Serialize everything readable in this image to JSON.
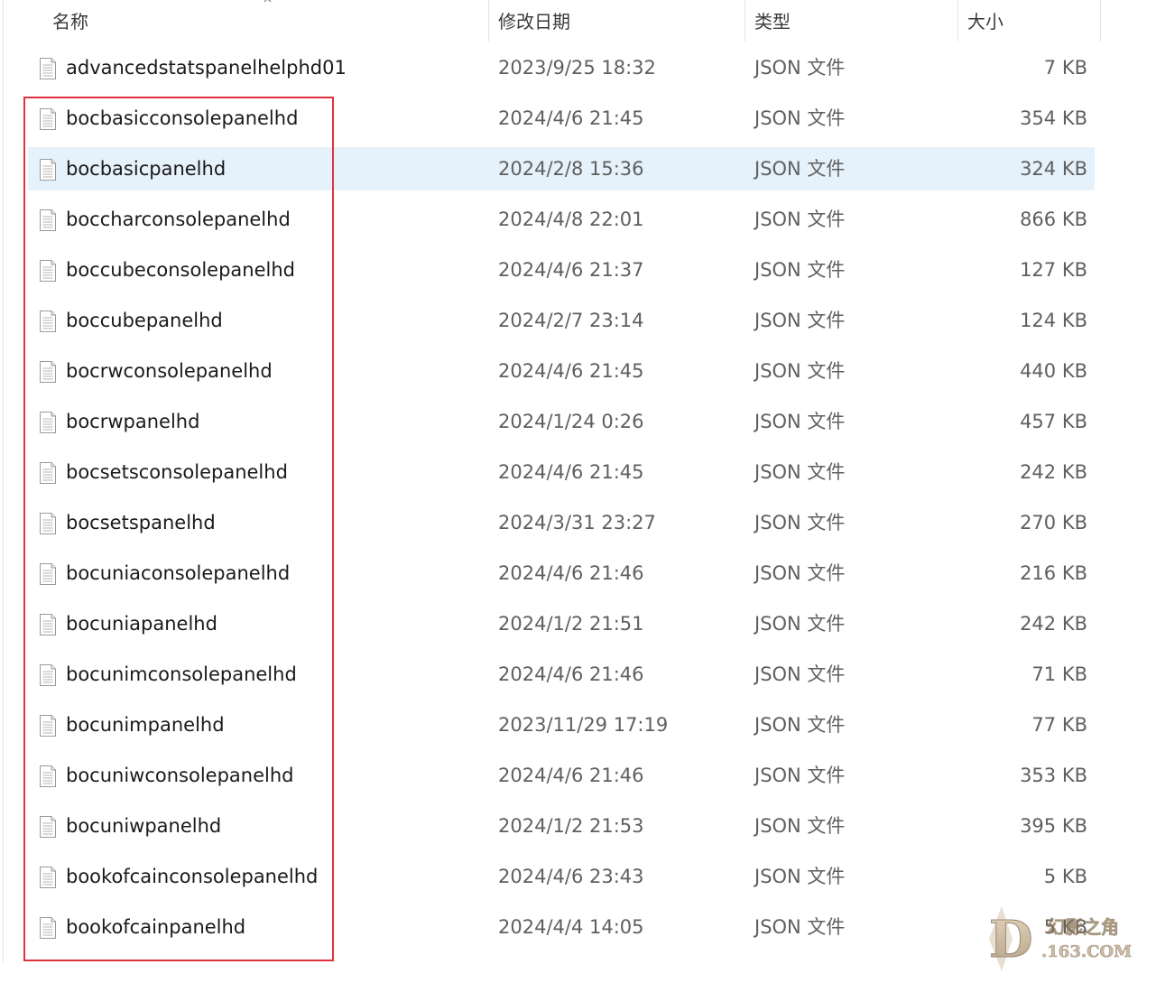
{
  "header": {
    "name_label": "名称",
    "date_label": "修改日期",
    "type_label": "类型",
    "size_label": "大小",
    "sort_indicator": "^"
  },
  "files": [
    {
      "name": "advancedstatspanelhelphd01",
      "date": "2023/9/25 18:32",
      "type": "JSON 文件",
      "size": "7 KB",
      "selected": false
    },
    {
      "name": "bocbasicconsolepanelhd",
      "date": "2024/4/6 21:45",
      "type": "JSON 文件",
      "size": "354 KB",
      "selected": false
    },
    {
      "name": "bocbasicpanelhd",
      "date": "2024/2/8 15:36",
      "type": "JSON 文件",
      "size": "324 KB",
      "selected": true
    },
    {
      "name": "boccharconsolepanelhd",
      "date": "2024/4/8 22:01",
      "type": "JSON 文件",
      "size": "866 KB",
      "selected": false
    },
    {
      "name": "boccubeconsolepanelhd",
      "date": "2024/4/6 21:37",
      "type": "JSON 文件",
      "size": "127 KB",
      "selected": false
    },
    {
      "name": "boccubepanelhd",
      "date": "2024/2/7 23:14",
      "type": "JSON 文件",
      "size": "124 KB",
      "selected": false
    },
    {
      "name": "bocrwconsolepanelhd",
      "date": "2024/4/6 21:45",
      "type": "JSON 文件",
      "size": "440 KB",
      "selected": false
    },
    {
      "name": "bocrwpanelhd",
      "date": "2024/1/24 0:26",
      "type": "JSON 文件",
      "size": "457 KB",
      "selected": false
    },
    {
      "name": "bocsetsconsolepanelhd",
      "date": "2024/4/6 21:45",
      "type": "JSON 文件",
      "size": "242 KB",
      "selected": false
    },
    {
      "name": "bocsetspanelhd",
      "date": "2024/3/31 23:27",
      "type": "JSON 文件",
      "size": "270 KB",
      "selected": false
    },
    {
      "name": "bocuniaconsolepanelhd",
      "date": "2024/4/6 21:46",
      "type": "JSON 文件",
      "size": "216 KB",
      "selected": false
    },
    {
      "name": "bocuniapanelhd",
      "date": "2024/1/2 21:51",
      "type": "JSON 文件",
      "size": "242 KB",
      "selected": false
    },
    {
      "name": "bocunimconsolepanelhd",
      "date": "2024/4/6 21:46",
      "type": "JSON 文件",
      "size": "71 KB",
      "selected": false
    },
    {
      "name": "bocunimpanelhd",
      "date": "2023/11/29 17:19",
      "type": "JSON 文件",
      "size": "77 KB",
      "selected": false
    },
    {
      "name": "bocuniwconsolepanelhd",
      "date": "2024/4/6 21:46",
      "type": "JSON 文件",
      "size": "353 KB",
      "selected": false
    },
    {
      "name": "bocuniwpanelhd",
      "date": "2024/1/2 21:53",
      "type": "JSON 文件",
      "size": "395 KB",
      "selected": false
    },
    {
      "name": "bookofcainconsolepanelhd",
      "date": "2024/4/6 23:43",
      "type": "JSON 文件",
      "size": "5 KB",
      "selected": false
    },
    {
      "name": "bookofcainpanelhd",
      "date": "2024/4/4 14:05",
      "type": "JSON 文件",
      "size": "5 KB",
      "selected": false
    }
  ],
  "watermark": {
    "letter": "D",
    "site_name": "幻影之角",
    "site_domain": ".163.COM"
  },
  "colors": {
    "selection_bg": "#e5f1fb",
    "highlight_border": "#e0323c",
    "secondary_text": "#5f5f5f"
  }
}
